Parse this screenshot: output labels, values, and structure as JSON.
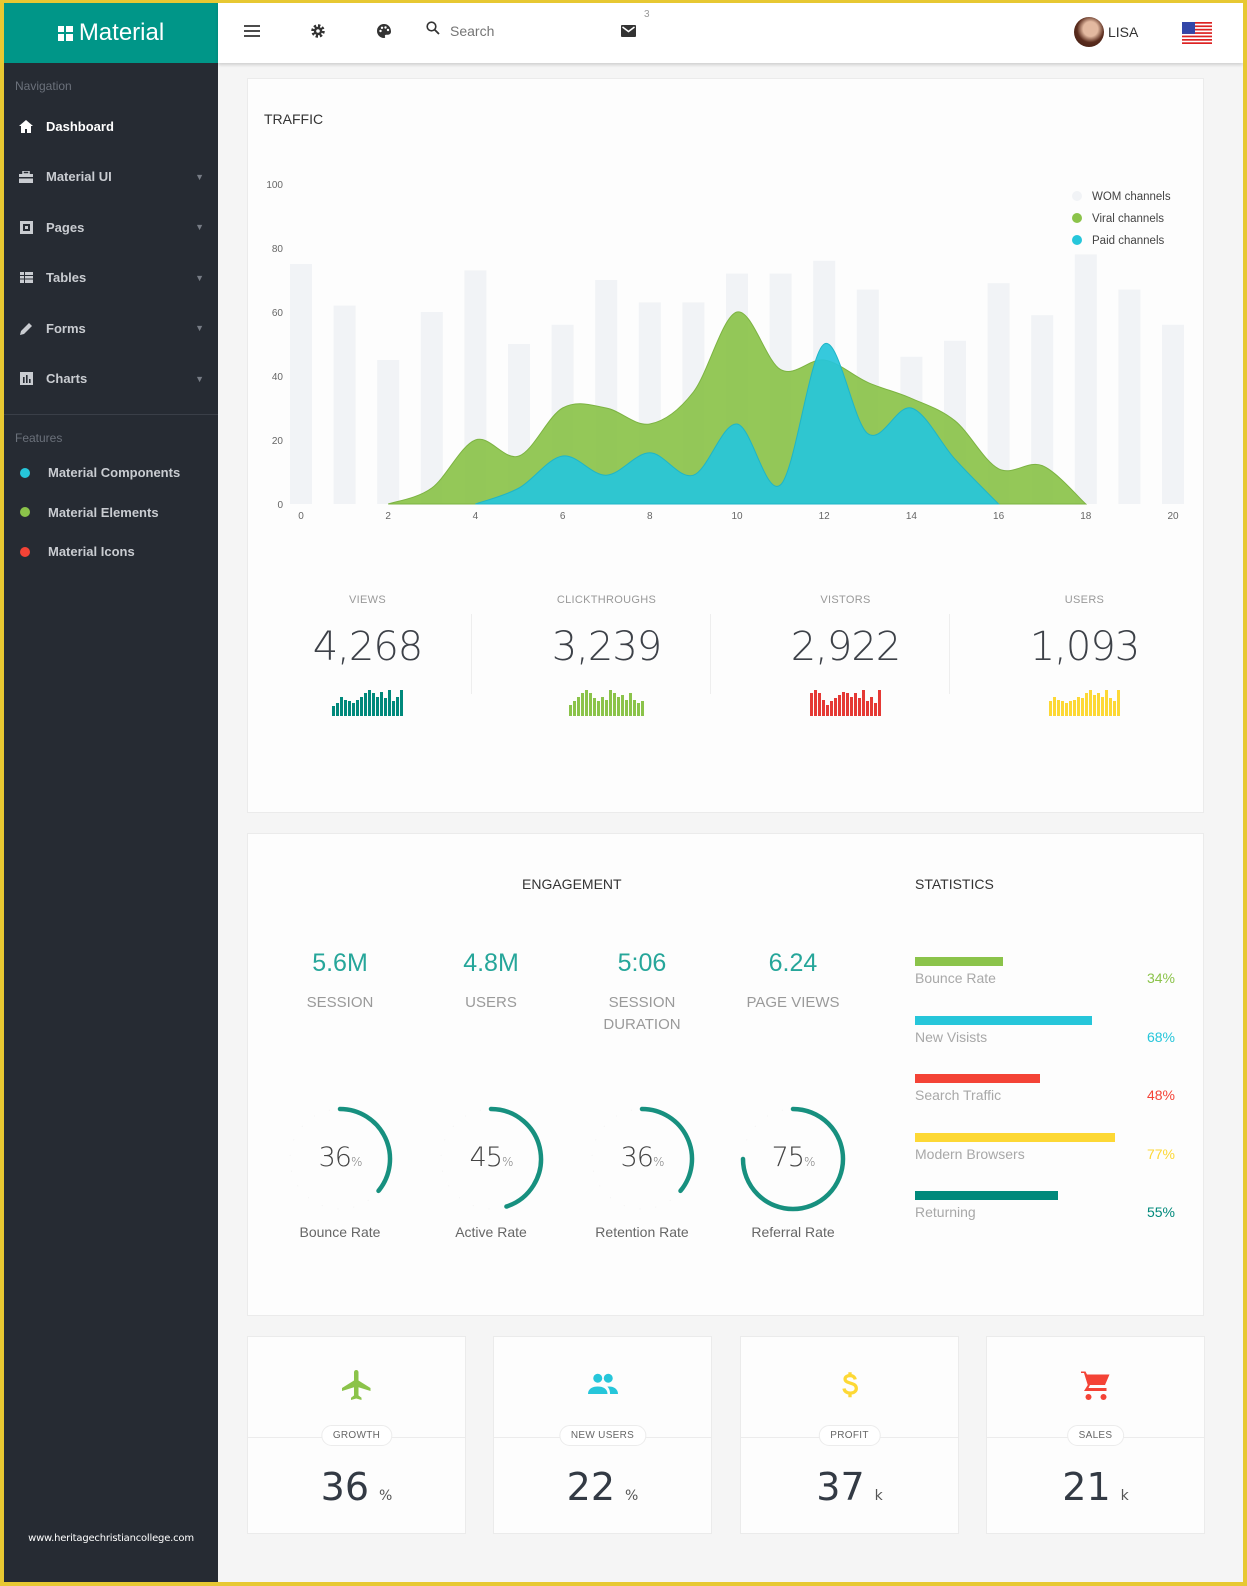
{
  "brand": {
    "name": "Material"
  },
  "topbar": {
    "search_placeholder": "Search",
    "mail_badge": "3",
    "user_name": "LISA"
  },
  "sidebar": {
    "nav_heading": "Navigation",
    "items": [
      {
        "label": "Dashboard",
        "icon": "home-icon",
        "active": true
      },
      {
        "label": "Material UI",
        "icon": "toolbox-icon"
      },
      {
        "label": "Pages",
        "icon": "pages-icon"
      },
      {
        "label": "Tables",
        "icon": "table-icon"
      },
      {
        "label": "Forms",
        "icon": "pencil-icon"
      },
      {
        "label": "Charts",
        "icon": "chart-icon"
      }
    ],
    "features_heading": "Features",
    "features": [
      {
        "label": "Material Components",
        "color": "#26c6da"
      },
      {
        "label": "Material Elements",
        "color": "#8bc34a"
      },
      {
        "label": "Material Icons",
        "color": "#f44336"
      }
    ],
    "footer_url": "www.heritagechristiancollege.com"
  },
  "traffic": {
    "title": "TRAFFIC",
    "stats": [
      {
        "label": "VIEWS",
        "value": "4,268",
        "color": "#00897b",
        "spark": [
          6,
          8,
          12,
          10,
          9,
          8,
          10,
          12,
          14,
          16,
          14,
          12,
          15,
          11,
          16,
          9,
          12,
          16
        ]
      },
      {
        "label": "CLICKTHROUGHS",
        "value": "3,239",
        "color": "#8bc34a",
        "spark": [
          7,
          9,
          12,
          14,
          16,
          14,
          11,
          9,
          12,
          10,
          16,
          14,
          12,
          13,
          10,
          14,
          10,
          8,
          9
        ]
      },
      {
        "label": "VISTORS",
        "value": "2,922",
        "color": "#e53935",
        "spark": [
          14,
          16,
          14,
          10,
          7,
          9,
          11,
          13,
          15,
          14,
          12,
          14,
          11,
          16,
          9,
          12,
          8,
          16
        ]
      },
      {
        "label": "USERS",
        "value": "1,093",
        "color": "#fdd835",
        "spark": [
          9,
          12,
          10,
          9,
          8,
          9,
          10,
          12,
          11,
          14,
          16,
          13,
          14,
          12,
          16,
          11,
          9,
          16
        ]
      }
    ]
  },
  "chart_data": {
    "type": "area",
    "title": "TRAFFIC",
    "x": [
      0,
      1,
      2,
      3,
      4,
      5,
      6,
      7,
      8,
      9,
      10,
      11,
      12,
      13,
      14,
      15,
      16,
      17,
      18,
      19,
      20
    ],
    "xticks": [
      0,
      2,
      4,
      6,
      8,
      10,
      12,
      14,
      16,
      18,
      20
    ],
    "yticks": [
      0,
      20,
      40,
      60,
      80,
      100
    ],
    "ylim": [
      0,
      100
    ],
    "xlim": [
      0,
      20
    ],
    "legend_position": "top-right",
    "series": [
      {
        "name": "WOM channels",
        "type": "bar",
        "color": "#f1f3f6",
        "values": [
          75,
          62,
          45,
          60,
          73,
          50,
          56,
          70,
          63,
          63,
          72,
          72,
          76,
          67,
          46,
          51,
          69,
          59,
          78,
          67,
          56
        ]
      },
      {
        "name": "Viral channels",
        "type": "area",
        "color": "#8bc34a",
        "values": [
          null,
          null,
          0,
          5,
          20,
          15,
          30,
          30,
          25,
          35,
          60,
          42,
          45,
          38,
          33,
          26,
          11,
          12,
          0,
          null,
          null
        ]
      },
      {
        "name": "Paid channels",
        "type": "area",
        "color": "#26c6da",
        "values": [
          null,
          null,
          null,
          null,
          0,
          5,
          15,
          9,
          16,
          9,
          25,
          6,
          50,
          22,
          30,
          14,
          0,
          null,
          null,
          null,
          null
        ]
      }
    ]
  },
  "engagement": {
    "title": "ENGAGEMENT",
    "stats": [
      {
        "value": "5.6M",
        "label": "SESSION"
      },
      {
        "value": "4.8M",
        "label": "USERS"
      },
      {
        "value": "5:06",
        "label": "SESSION DURATION"
      },
      {
        "value": "6.24",
        "label": "PAGE VIEWS"
      }
    ],
    "gauges": [
      {
        "value": 36,
        "unit": "%",
        "label": "Bounce Rate"
      },
      {
        "value": 45,
        "unit": "%",
        "label": "Active Rate"
      },
      {
        "value": 36,
        "unit": "%",
        "label": "Retention Rate"
      },
      {
        "value": 75,
        "unit": "%",
        "label": "Referral Rate"
      }
    ],
    "gauge_color": "#17907f"
  },
  "statistics": {
    "title": "STATISTICS",
    "rows": [
      {
        "label": "Bounce Rate",
        "value": 34,
        "display": "34%",
        "color": "#8bc34a"
      },
      {
        "label": "New Visists",
        "value": 68,
        "display": "68%",
        "color": "#26c6da"
      },
      {
        "label": "Search Traffic",
        "value": 48,
        "display": "48%",
        "color": "#f44336"
      },
      {
        "label": "Modern Browsers",
        "value": 77,
        "display": "77%",
        "color": "#fdd835"
      },
      {
        "label": "Returning",
        "value": 55,
        "display": "55%",
        "color": "#00897b"
      }
    ]
  },
  "mini_cards": [
    {
      "label": "GROWTH",
      "value": "36",
      "unit": "%",
      "icon": "airplane-icon",
      "color": "#8bc34a"
    },
    {
      "label": "NEW USERS",
      "value": "22",
      "unit": "%",
      "icon": "people-icon",
      "color": "#26c6da"
    },
    {
      "label": "PROFIT",
      "value": "37",
      "unit": "k",
      "icon": "dollar-icon",
      "color": "#fdd835"
    },
    {
      "label": "SALES",
      "value": "21",
      "unit": "k",
      "icon": "cart-icon",
      "color": "#f44336"
    }
  ]
}
